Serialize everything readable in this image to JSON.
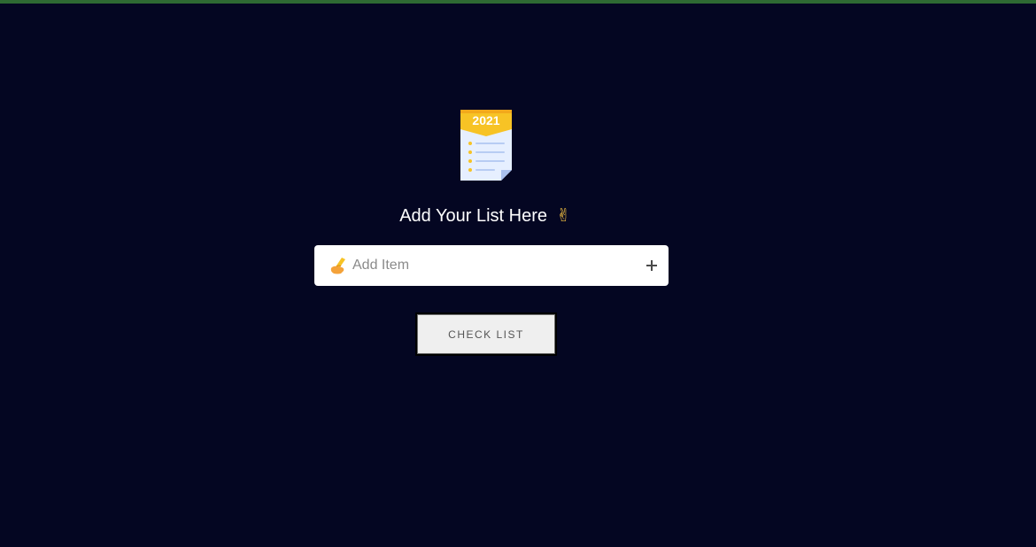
{
  "logo": {
    "icon": "checklist-2021-icon",
    "year_label": "2021"
  },
  "header": {
    "title": "Add Your List Here",
    "title_emoji": "✌",
    "title_emoji_icon": "victory-hand-icon"
  },
  "item_input": {
    "icon": "writing-hand-icon",
    "placeholder": "Add Item",
    "value": "",
    "add_icon": "plus-icon"
  },
  "actions": {
    "check_list_label": "CHECK LIST"
  },
  "colors": {
    "background": "#040622",
    "top_bar": "#2e6a33",
    "logo_banner": "#f7c325",
    "paper": "#e6efff",
    "button_bg": "#efefef"
  }
}
